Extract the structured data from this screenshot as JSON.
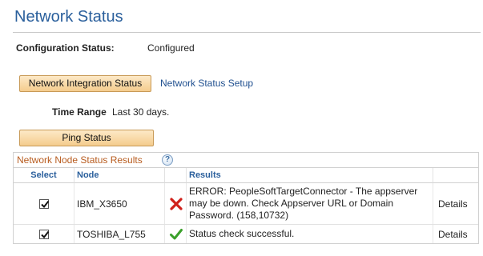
{
  "page": {
    "title": "Network Status"
  },
  "config": {
    "label": "Configuration Status:",
    "value": "Configured"
  },
  "actions": {
    "network_integration_status": "Network Integration Status",
    "network_status_setup": "Network Status Setup",
    "ping_status": "Ping Status"
  },
  "time_range": {
    "label": "Time Range",
    "value": "Last 30 days."
  },
  "grid": {
    "title": "Network Node Status Results",
    "help_icon": "?",
    "columns": {
      "select": "Select",
      "node": "Node",
      "results": "Results",
      "details": ""
    },
    "rows": [
      {
        "checked": true,
        "node": "IBM_X3650",
        "status_icon": "error-x-icon",
        "result": "ERROR: PeopleSoftTargetConnector - The appserver may be down.  Check Appserver URL or Domain Password. (158,10732)",
        "details": "Details"
      },
      {
        "checked": true,
        "node": "TOSHIBA_L755",
        "status_icon": "success-check-icon",
        "result": "Status check successful.",
        "details": "Details"
      }
    ]
  },
  "colors": {
    "title": "#2a5f9c",
    "grid_title": "#b85c1f",
    "error": "#d0201a",
    "success": "#3aa02a"
  }
}
